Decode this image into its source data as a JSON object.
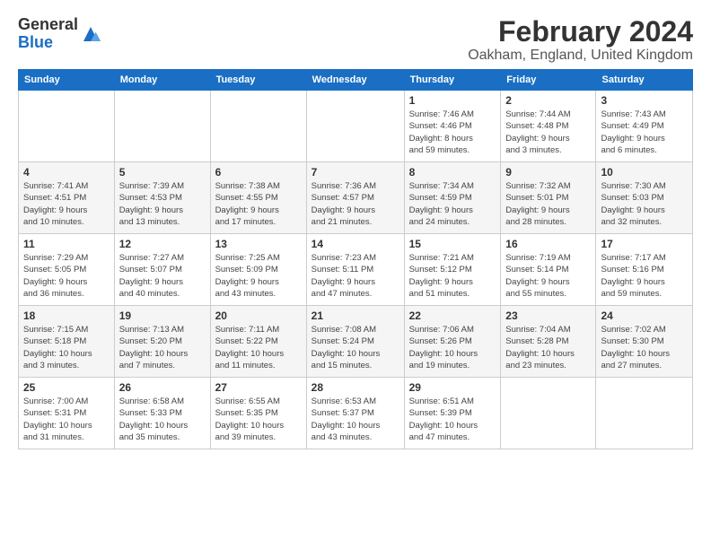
{
  "header": {
    "logo_line1": "General",
    "logo_line2": "Blue",
    "title": "February 2024",
    "subtitle": "Oakham, England, United Kingdom"
  },
  "weekdays": [
    "Sunday",
    "Monday",
    "Tuesday",
    "Wednesday",
    "Thursday",
    "Friday",
    "Saturday"
  ],
  "weeks": [
    [
      {
        "day": "",
        "info": ""
      },
      {
        "day": "",
        "info": ""
      },
      {
        "day": "",
        "info": ""
      },
      {
        "day": "",
        "info": ""
      },
      {
        "day": "1",
        "info": "Sunrise: 7:46 AM\nSunset: 4:46 PM\nDaylight: 8 hours\nand 59 minutes."
      },
      {
        "day": "2",
        "info": "Sunrise: 7:44 AM\nSunset: 4:48 PM\nDaylight: 9 hours\nand 3 minutes."
      },
      {
        "day": "3",
        "info": "Sunrise: 7:43 AM\nSunset: 4:49 PM\nDaylight: 9 hours\nand 6 minutes."
      }
    ],
    [
      {
        "day": "4",
        "info": "Sunrise: 7:41 AM\nSunset: 4:51 PM\nDaylight: 9 hours\nand 10 minutes."
      },
      {
        "day": "5",
        "info": "Sunrise: 7:39 AM\nSunset: 4:53 PM\nDaylight: 9 hours\nand 13 minutes."
      },
      {
        "day": "6",
        "info": "Sunrise: 7:38 AM\nSunset: 4:55 PM\nDaylight: 9 hours\nand 17 minutes."
      },
      {
        "day": "7",
        "info": "Sunrise: 7:36 AM\nSunset: 4:57 PM\nDaylight: 9 hours\nand 21 minutes."
      },
      {
        "day": "8",
        "info": "Sunrise: 7:34 AM\nSunset: 4:59 PM\nDaylight: 9 hours\nand 24 minutes."
      },
      {
        "day": "9",
        "info": "Sunrise: 7:32 AM\nSunset: 5:01 PM\nDaylight: 9 hours\nand 28 minutes."
      },
      {
        "day": "10",
        "info": "Sunrise: 7:30 AM\nSunset: 5:03 PM\nDaylight: 9 hours\nand 32 minutes."
      }
    ],
    [
      {
        "day": "11",
        "info": "Sunrise: 7:29 AM\nSunset: 5:05 PM\nDaylight: 9 hours\nand 36 minutes."
      },
      {
        "day": "12",
        "info": "Sunrise: 7:27 AM\nSunset: 5:07 PM\nDaylight: 9 hours\nand 40 minutes."
      },
      {
        "day": "13",
        "info": "Sunrise: 7:25 AM\nSunset: 5:09 PM\nDaylight: 9 hours\nand 43 minutes."
      },
      {
        "day": "14",
        "info": "Sunrise: 7:23 AM\nSunset: 5:11 PM\nDaylight: 9 hours\nand 47 minutes."
      },
      {
        "day": "15",
        "info": "Sunrise: 7:21 AM\nSunset: 5:12 PM\nDaylight: 9 hours\nand 51 minutes."
      },
      {
        "day": "16",
        "info": "Sunrise: 7:19 AM\nSunset: 5:14 PM\nDaylight: 9 hours\nand 55 minutes."
      },
      {
        "day": "17",
        "info": "Sunrise: 7:17 AM\nSunset: 5:16 PM\nDaylight: 9 hours\nand 59 minutes."
      }
    ],
    [
      {
        "day": "18",
        "info": "Sunrise: 7:15 AM\nSunset: 5:18 PM\nDaylight: 10 hours\nand 3 minutes."
      },
      {
        "day": "19",
        "info": "Sunrise: 7:13 AM\nSunset: 5:20 PM\nDaylight: 10 hours\nand 7 minutes."
      },
      {
        "day": "20",
        "info": "Sunrise: 7:11 AM\nSunset: 5:22 PM\nDaylight: 10 hours\nand 11 minutes."
      },
      {
        "day": "21",
        "info": "Sunrise: 7:08 AM\nSunset: 5:24 PM\nDaylight: 10 hours\nand 15 minutes."
      },
      {
        "day": "22",
        "info": "Sunrise: 7:06 AM\nSunset: 5:26 PM\nDaylight: 10 hours\nand 19 minutes."
      },
      {
        "day": "23",
        "info": "Sunrise: 7:04 AM\nSunset: 5:28 PM\nDaylight: 10 hours\nand 23 minutes."
      },
      {
        "day": "24",
        "info": "Sunrise: 7:02 AM\nSunset: 5:30 PM\nDaylight: 10 hours\nand 27 minutes."
      }
    ],
    [
      {
        "day": "25",
        "info": "Sunrise: 7:00 AM\nSunset: 5:31 PM\nDaylight: 10 hours\nand 31 minutes."
      },
      {
        "day": "26",
        "info": "Sunrise: 6:58 AM\nSunset: 5:33 PM\nDaylight: 10 hours\nand 35 minutes."
      },
      {
        "day": "27",
        "info": "Sunrise: 6:55 AM\nSunset: 5:35 PM\nDaylight: 10 hours\nand 39 minutes."
      },
      {
        "day": "28",
        "info": "Sunrise: 6:53 AM\nSunset: 5:37 PM\nDaylight: 10 hours\nand 43 minutes."
      },
      {
        "day": "29",
        "info": "Sunrise: 6:51 AM\nSunset: 5:39 PM\nDaylight: 10 hours\nand 47 minutes."
      },
      {
        "day": "",
        "info": ""
      },
      {
        "day": "",
        "info": ""
      }
    ]
  ]
}
